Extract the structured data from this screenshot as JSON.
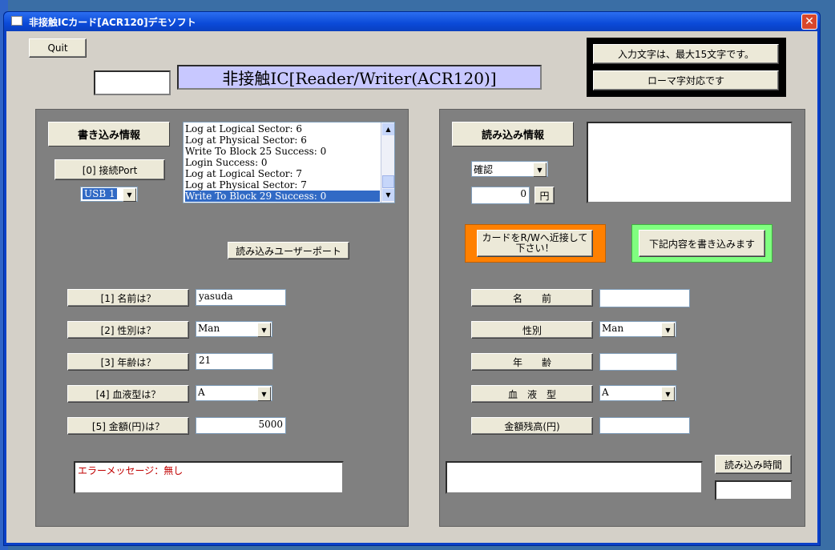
{
  "window": {
    "title": "非接触ICカード[ACR120]デモソフト",
    "close_glyph": "✕"
  },
  "top": {
    "quit_label": "Quit",
    "small_input_value": "",
    "banner_title": "非接触IC[Reader/Writer(ACR120)]",
    "info_button_1": "入力文字は、最大15文字です。",
    "info_button_2": "ローマ字対応です"
  },
  "left_panel": {
    "header": "書き込み情報",
    "connect_port_label": "[0] 接続Port",
    "port_select": "USB 1",
    "log_lines": [
      "Log at Logical Sector: 6",
      "Log at Physical Sector: 6",
      "Write To Block 25 Success: 0",
      "Login Success: 0",
      "Log at Logical Sector: 7",
      "Log at Physical Sector: 7",
      "Write To Block 29 Success: 0"
    ],
    "read_user_support": "読み込みユーザーポート",
    "fields": [
      {
        "label": "[1] 名前は？",
        "value": "yasuda"
      },
      {
        "label": "[2] 性別は？",
        "value": "Man"
      },
      {
        "label": "[3] 年齢は？",
        "value": "21"
      },
      {
        "label": "[4] 血液型は？",
        "value": "A"
      },
      {
        "label": "[5] 金額(円)は？",
        "value": "5000"
      }
    ],
    "error_message": "エラーメッセージ：無し"
  },
  "right_panel": {
    "header": "読み込み情報",
    "confirm_select": "確認",
    "amount_value": "0",
    "yen_label": "円",
    "approach_button": "カードをR/Wへ近接して下さい！",
    "write_button": "下記内容を書き込みます",
    "fields": [
      {
        "label": "名　　前",
        "value": ""
      },
      {
        "label": "性別",
        "value": "Man"
      },
      {
        "label": "年　　齢",
        "value": ""
      },
      {
        "label": "血　液　型",
        "value": "A"
      },
      {
        "label": "金額残高(円)",
        "value": ""
      }
    ],
    "read_time_button": "読み込み時間",
    "read_time_value": "",
    "message_box": ""
  },
  "colors": {
    "titlebar": "#0b4ad8",
    "banner_bg": "#c8c8ff",
    "approach_button": "#ff8000",
    "write_button": "#80ff80",
    "error_text": "#c00000",
    "list_selection": "#316ac5"
  }
}
